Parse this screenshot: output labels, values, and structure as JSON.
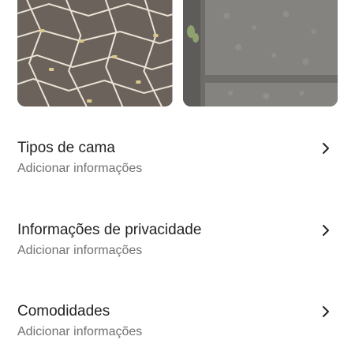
{
  "photos": [
    {
      "icon": "bed-photo-patterned-bedspread",
      "colors": {
        "base": "#6b625c",
        "lines": "#e9e4d4",
        "accent": "#d9c98d"
      }
    },
    {
      "icon": "bed-photo-gray-floral-bedspread",
      "colors": {
        "base": "#7d7b78",
        "border": "#5e5c5a",
        "pattern": "#9a9791"
      }
    }
  ],
  "sections": [
    {
      "title": "Tipos de cama",
      "subtitle": "Adicionar informações"
    },
    {
      "title": "Informações de privacidade",
      "subtitle": "Adicionar informações"
    },
    {
      "title": "Comodidades",
      "subtitle": "Adicionar informações"
    }
  ],
  "colors": {
    "title_text": "#222222",
    "subtitle_text": "#717171",
    "background": "#ffffff"
  }
}
